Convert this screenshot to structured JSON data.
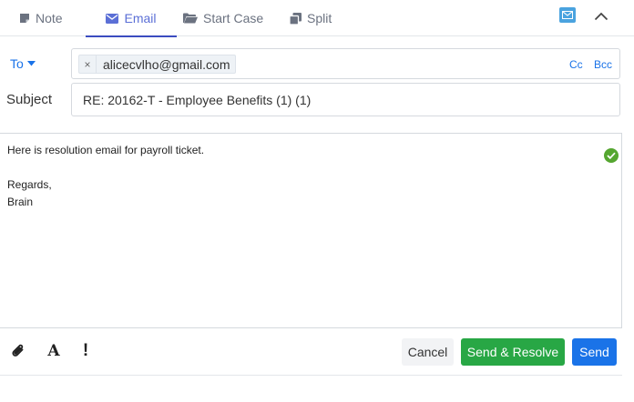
{
  "tabs": {
    "note": "Note",
    "email": "Email",
    "start_case": "Start Case",
    "split": "Split",
    "active": "Email"
  },
  "header_icons": [
    "envelope-icon",
    "chevron-up-icon"
  ],
  "compose": {
    "to_label": "To",
    "recipients": [
      {
        "remove": "×",
        "email": "alicecvlho@gmail.com"
      }
    ],
    "cc_label": "Cc",
    "bcc_label": "Bcc",
    "subject_label": "Subject",
    "subject_value": "RE: 20162-T - Employee Benefits (1) (1)",
    "body_text": "Here is resolution email for payroll ticket.\n\nRegards,\nBrain"
  },
  "toolbar": {
    "format_label": "A",
    "importance_label": "!",
    "cancel_label": "Cancel",
    "send_resolve_label": "Send & Resolve",
    "send_label": "Send"
  },
  "colors": {
    "link_blue": "#1a73e8",
    "active_tab": "#5b6fd6",
    "resolve_green": "#28a745",
    "check_green": "#55a630"
  }
}
